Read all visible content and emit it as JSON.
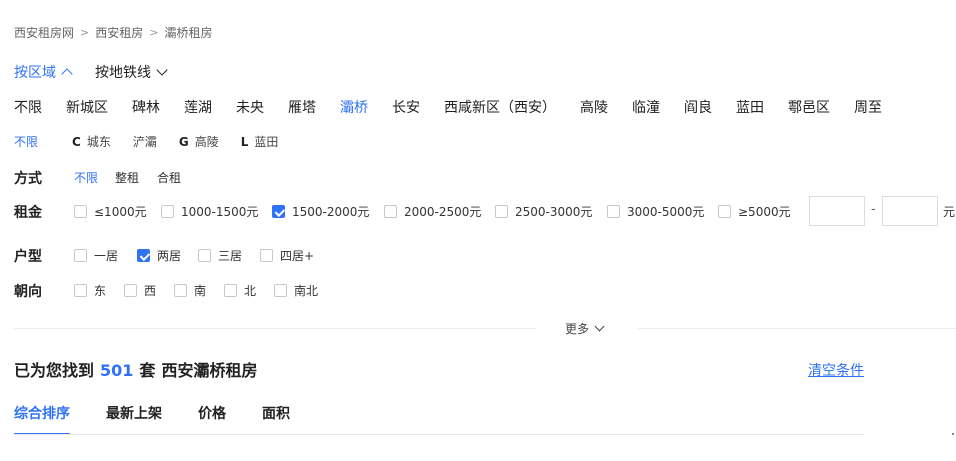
{
  "breadcrumb": [
    "西安租房网",
    "西安租房",
    "灞桥租房"
  ],
  "breadcrumb_sep": ">",
  "search_tabs": [
    {
      "label": "按区域",
      "active": true,
      "chevron": "up"
    },
    {
      "label": "按地铁线",
      "active": false,
      "chevron": "down"
    }
  ],
  "districts": [
    "不限",
    "新城区",
    "碑林",
    "莲湖",
    "未央",
    "雁塔",
    "灞桥",
    "长安",
    "西咸新区（西安）",
    "高陵",
    "临潼",
    "阎良",
    "蓝田",
    "鄠邑区",
    "周至"
  ],
  "district_active": "灞桥",
  "sub_areas": [
    {
      "letter": "",
      "label": "不限",
      "active": true
    },
    {
      "letter": "C",
      "label": "城东",
      "active": false
    },
    {
      "letter": "",
      "label": "浐灞",
      "active": false
    },
    {
      "letter": "G",
      "label": "高陵",
      "active": false
    },
    {
      "letter": "L",
      "label": "蓝田",
      "active": false
    }
  ],
  "filters": {
    "method": {
      "label": "方式",
      "options": [
        "不限",
        "整租",
        "合租"
      ],
      "active": "不限"
    },
    "rent": {
      "label": "租金",
      "options": [
        {
          "label": "≤1000元",
          "checked": false
        },
        {
          "label": "1000-1500元",
          "checked": false
        },
        {
          "label": "1500-2000元",
          "checked": true
        },
        {
          "label": "2000-2500元",
          "checked": false
        },
        {
          "label": "2500-3000元",
          "checked": false
        },
        {
          "label": "3000-5000元",
          "checked": false
        },
        {
          "label": "≥5000元",
          "checked": false
        }
      ],
      "range_sep": "-",
      "unit": "元",
      "min_value": "",
      "max_value": ""
    },
    "layout": {
      "label": "户型",
      "options": [
        {
          "label": "一居",
          "checked": false
        },
        {
          "label": "两居",
          "checked": true
        },
        {
          "label": "三居",
          "checked": false
        },
        {
          "label": "四居+",
          "checked": false
        }
      ]
    },
    "orientation": {
      "label": "朝向",
      "options": [
        {
          "label": "东",
          "checked": false
        },
        {
          "label": "西",
          "checked": false
        },
        {
          "label": "南",
          "checked": false
        },
        {
          "label": "北",
          "checked": false
        },
        {
          "label": "南北",
          "checked": false
        }
      ]
    }
  },
  "more_label": "更多",
  "result": {
    "prefix": "已为您找到",
    "count": "501",
    "unit": "套",
    "suffix": "西安灞桥租房"
  },
  "clear_label": "清空条件",
  "sort_tabs": [
    {
      "label": "综合排序",
      "active": true
    },
    {
      "label": "最新上架",
      "active": false
    },
    {
      "label": "价格",
      "active": false
    },
    {
      "label": "面积",
      "active": false
    }
  ],
  "colors": {
    "accent": "#3072f6",
    "text": "#222222",
    "muted": "#666666"
  }
}
